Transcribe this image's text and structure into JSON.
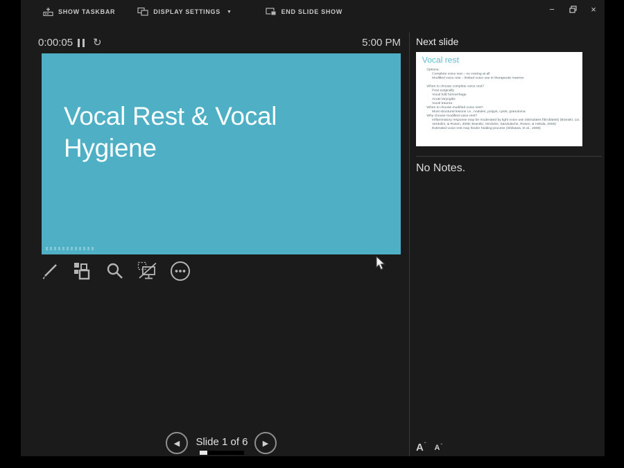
{
  "title_bar": {
    "show_taskbar": "SHOW TASKBAR",
    "display_settings": "DISPLAY SETTINGS",
    "display_settings_caret": "▼",
    "end_slide_show": "END SLIDE SHOW",
    "minimize": "−",
    "close": "×"
  },
  "status": {
    "elapsed": "0:00:05",
    "clock": "5:00 PM"
  },
  "slide": {
    "title": "Vocal Rest & Vocal Hygiene",
    "background": "#4FB0C5"
  },
  "navigation": {
    "label": "Slide 1 of 6",
    "prev": "◀",
    "next": "▶",
    "progress": {
      "current": 1,
      "total": 6
    }
  },
  "next_slide_panel": {
    "header": "Next slide",
    "notes": "No Notes.",
    "thumbnail": {
      "title": "Vocal rest",
      "title_color": "#5FBBD0",
      "lines": [
        {
          "t": "Options:",
          "i": 1
        },
        {
          "t": "Complete voice rest – no voicing at all",
          "i": 2
        },
        {
          "t": "Modified voice rest – limited voice use in therapeutic manner",
          "i": 2
        },
        {
          "t": "",
          "i": 0
        },
        {
          "t": "When to choose complete voice rest?",
          "i": 1
        },
        {
          "t": "Post surgically",
          "i": 2
        },
        {
          "t": "Vocal fold hemorrhage",
          "i": 2
        },
        {
          "t": "Acute laryngitis",
          "i": 2
        },
        {
          "t": "Vocal trauma",
          "i": 2
        },
        {
          "t": "When to choose modified voice rest?",
          "i": 1
        },
        {
          "t": "Most structural lesions i.e., nodules, polyps, cysts, granuloma",
          "i": 2
        },
        {
          "t": "Why choose modified voice rest?",
          "i": 1
        },
        {
          "t": "Inflammatory response may be moderated by light voice use (stimulates fibroblasts) (Branski, Lin, Verdolini, & Rosen, 2008; Branski, Verdolini, Sandulache, Rosen, & Hebda, 2006)",
          "i": 2
        },
        {
          "t": "Extended voice rest may hinder healing process (Ishikawa, et al., 2008)",
          "i": 2
        }
      ]
    }
  },
  "font_size_controls": {
    "increase": "A",
    "increase_mark": "ˆ",
    "decrease": "A",
    "decrease_mark": "ˇ"
  },
  "icons": {
    "restart": "↻"
  },
  "colors": {
    "accent_teal": "#4FB0C5",
    "window_bg": "#1b1b1b",
    "outer_bg": "#000000"
  }
}
